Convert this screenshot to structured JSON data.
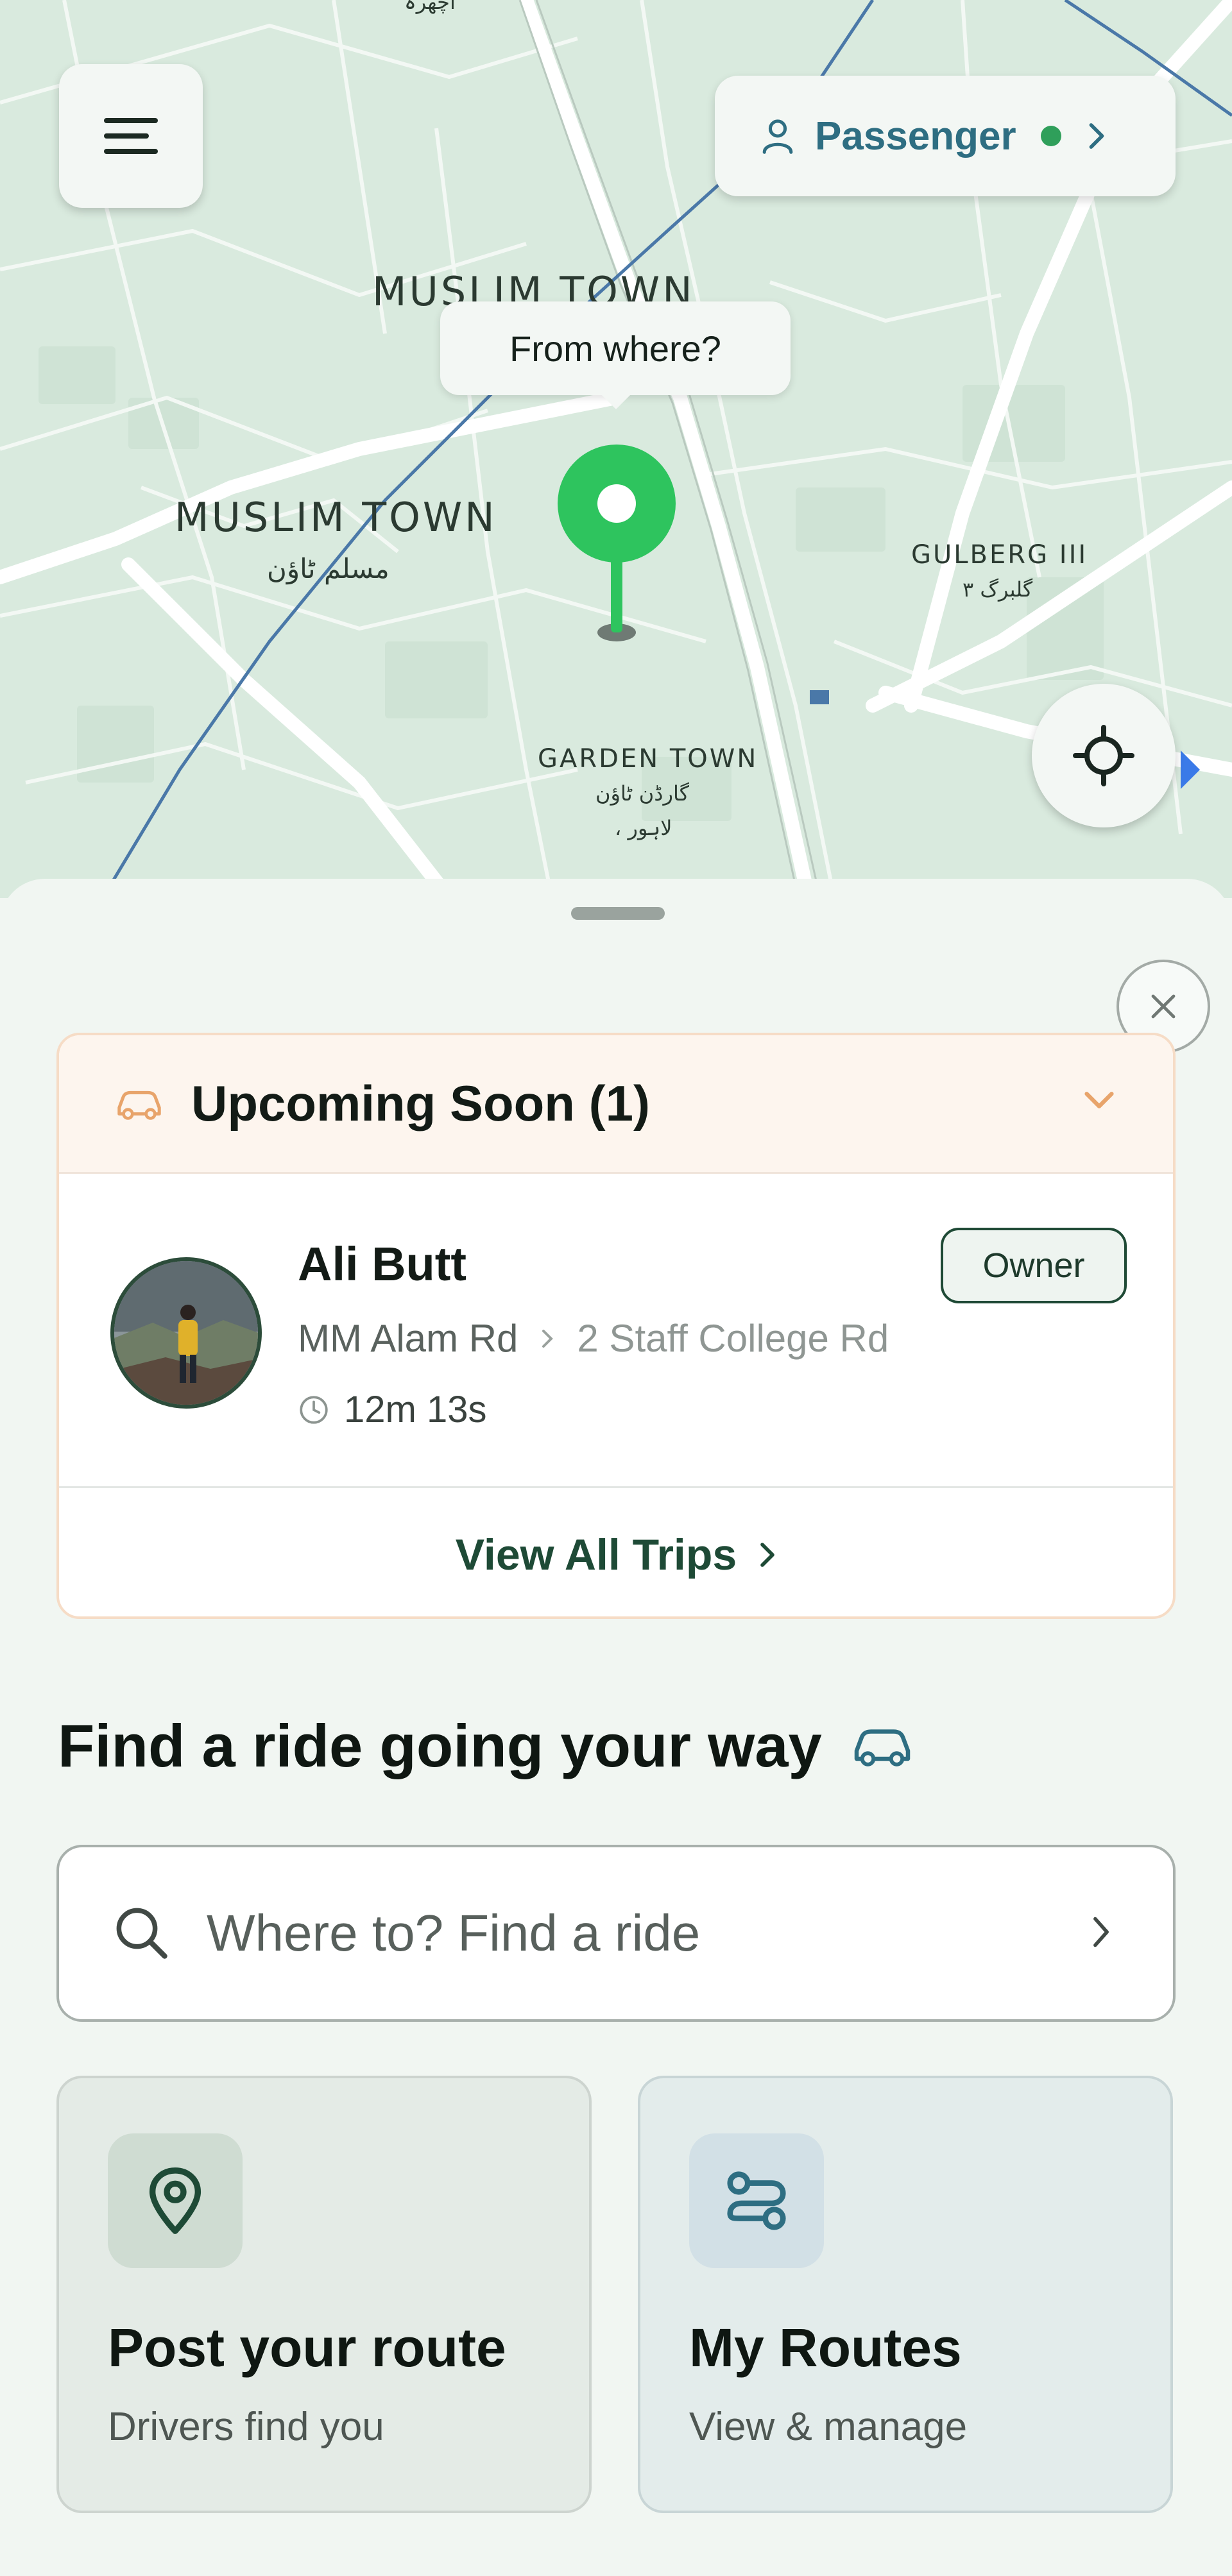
{
  "map": {
    "labels": {
      "muslim_town_top": "MUSLIM TOWN",
      "muslim_town": "MUSLIM TOWN",
      "muslim_town_urdu": "مسلم ٹاؤن",
      "gulberg": "GULBERG III",
      "gulberg_urdu": "گلبرگ ۳",
      "garden_town": "GARDEN TOWN",
      "garden_town_urdu": "گارڈن ٹاؤن",
      "lahore_urdu": "، لاہور",
      "top_urdu": "اچھرہ"
    },
    "tooltip": "From where?"
  },
  "header": {
    "menu_icon": "hamburger-menu-icon",
    "mode_label": "Passenger",
    "mode_icon": "user-icon",
    "status_color": "#2f9f5a"
  },
  "upcoming": {
    "title": "Upcoming Soon (1)",
    "trip": {
      "driver_name": "Ali Butt",
      "role_badge": "Owner",
      "from": "MM Alam Rd",
      "to": "2 Staff College Rd",
      "eta": "12m 13s"
    },
    "view_all": "View All Trips"
  },
  "find": {
    "title": "Find a ride going your way",
    "search_placeholder": "Where to? Find a ride"
  },
  "cards": {
    "post": {
      "title": "Post your route",
      "subtitle": "Drivers find you",
      "icon": "map-pin-icon"
    },
    "routes": {
      "title": "My Routes",
      "subtitle": "View & manage",
      "icon": "route-icon"
    }
  },
  "colors": {
    "accent_green": "#2ec45e",
    "brand_dark_green": "#1e4a36",
    "passenger_blue": "#2e6e82",
    "upcoming_orange": "#e8a46b"
  }
}
